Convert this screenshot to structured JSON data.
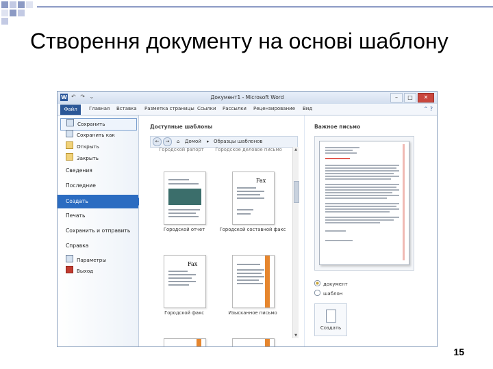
{
  "slide": {
    "title": "Створення документу на основі шаблону",
    "page_number": "15"
  },
  "window": {
    "title": "Документ1 - Microsoft Word",
    "quick_access": "↶ ↷ ⌄",
    "controls": {
      "minimize": "–",
      "maximize": "□",
      "close": "✕"
    }
  },
  "ribbon": {
    "file_tab": "Файл",
    "tabs": [
      "Главная",
      "Вставка",
      "Разметка страницы",
      "Ссылки",
      "Рассылки",
      "Рецензирование",
      "Вид"
    ],
    "help_icons": "⌃ ?"
  },
  "backstage": {
    "items": [
      "Сохранить",
      "Сохранить как",
      "Открыть",
      "Закрыть"
    ],
    "sections": [
      "Сведения",
      "Последние",
      "Создать",
      "Печать",
      "Сохранить и отправить",
      "Справка"
    ],
    "bottom_items": [
      "Параметры",
      "Выход"
    ],
    "active_section": "Создать"
  },
  "templates": {
    "header": "Доступные шаблоны",
    "back_button": "←",
    "forward_button": "→",
    "home_icon": "⌂",
    "breadcrumb_home": "Домой",
    "breadcrumb_separator": "▸",
    "breadcrumb_current": "Образцы шаблонов",
    "top_partial_captions": [
      "Городской рапорт",
      "Городское деловое письмо"
    ],
    "captions": [
      "Городской отчет",
      "Городской составной факс",
      "Городской факс",
      "Изысканное письмо"
    ],
    "fax_label": "Fax"
  },
  "preview": {
    "header": "Важное письмо",
    "options": [
      "документ",
      "шаблон"
    ],
    "selected_option": "документ",
    "create_label": "Создать"
  },
  "colors": {
    "accent": "#2b6cc1",
    "file_tab": "#2b5797",
    "close": "#c9473e",
    "slide_bar": "#8c9ac4"
  }
}
